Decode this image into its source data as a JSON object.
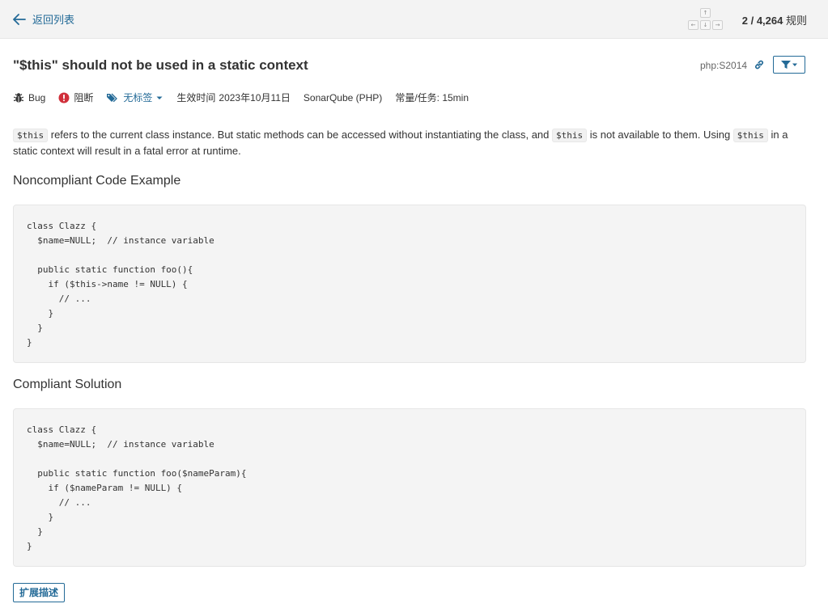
{
  "nav": {
    "back_label": "返回列表",
    "key_up": "↑",
    "key_left": "←",
    "key_down": "↓",
    "key_right": "→",
    "counter_current": "2",
    "counter_sep": " / ",
    "counter_total": "4,264",
    "counter_suffix": " 规则"
  },
  "rule": {
    "title": "\"$this\" should not be used in a static context",
    "key": "php:S2014"
  },
  "meta": {
    "type": "Bug",
    "severity": "阻断",
    "tags": "无标签",
    "effective_label": "生效时间",
    "effective_date": "2023年10月11日",
    "repository": "SonarQube (PHP)",
    "effort": "常量/任务: 15min"
  },
  "description": {
    "code_this": "$this",
    "text1": " refers to the current class instance. But static methods can be accessed without instantiating the class, and ",
    "text2": " is not available to them. Using ",
    "text3": " in a static context will result in a fatal error at runtime."
  },
  "noncompliant": {
    "heading": "Noncompliant Code Example",
    "code": "class Clazz {\n  $name=NULL;  // instance variable\n\n  public static function foo(){\n    if ($this->name != NULL) {\n      // ...\n    }\n  }\n}"
  },
  "compliant": {
    "heading": "Compliant Solution",
    "code": "class Clazz {\n  $name=NULL;  // instance variable\n\n  public static function foo($nameParam){\n    if ($nameParam != NULL) {\n      // ...\n    }\n  }\n}"
  },
  "actions": {
    "extend_label": "扩展描述"
  },
  "colors": {
    "accent": "#236a97",
    "blocker": "#d02f3a"
  }
}
